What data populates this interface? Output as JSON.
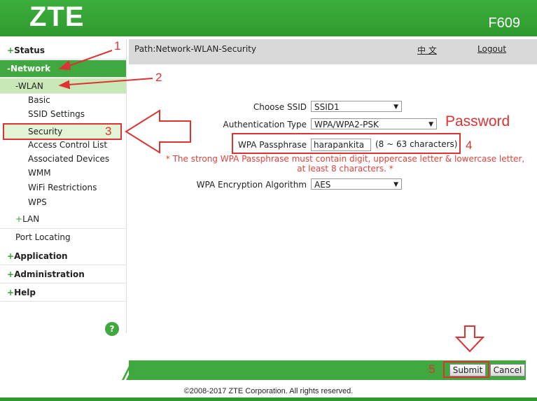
{
  "header": {
    "brand": "ZTE",
    "model": "F609"
  },
  "sidebar": {
    "status": "Status",
    "network": "-Network",
    "wlan": "-WLAN",
    "wlan_items": [
      "Basic",
      "SSID Settings",
      "Security",
      "Access Control List",
      "Associated Devices",
      "WMM",
      "WiFi Restrictions",
      "WPS"
    ],
    "lan": "LAN",
    "port_locating": "Port Locating",
    "application": "Application",
    "administration": "Administration",
    "help": "Help",
    "help_icon": "?"
  },
  "pathbar": {
    "path": "Path:Network-WLAN-Security",
    "lang": "中 文",
    "logout": "Logout"
  },
  "form": {
    "ssid_label": "Choose SSID",
    "ssid_value": "SSID1",
    "auth_label": "Authentication Type",
    "auth_value": "WPA/WPA2-PSK",
    "pass_label": "WPA Passphrase",
    "pass_value": "harapankita",
    "pass_hint": "(8 ~ 63 characters)",
    "warning": "* The strong WPA Passphrase must contain digit, uppercase letter & lowercase letter, at least 8 characters. *",
    "enc_label": "WPA Encryption Algorithm",
    "enc_value": "AES"
  },
  "annotations": {
    "n1": "1",
    "n2": "2",
    "n3": "3",
    "n4": "4",
    "n5": "5",
    "password_note": "Password",
    "color": "#d33333"
  },
  "buttons": {
    "submit": "Submit",
    "cancel": "Cancel"
  },
  "footer": {
    "copyright": "©2008-2017 ZTE Corporation. All rights reserved."
  }
}
